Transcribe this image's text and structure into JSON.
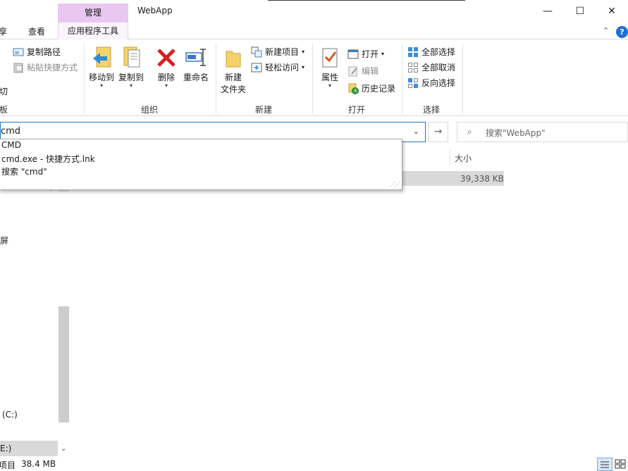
{
  "window": {
    "title": "WebApp",
    "context_header": "管理",
    "buttons": {
      "minimize": "—",
      "maximize": "☐",
      "close": "✕"
    }
  },
  "tabs": {
    "share": "享",
    "view": "查看",
    "app_tools": "应用程序工具"
  },
  "ribbon": {
    "clipboard": {
      "copy_path": "复制路径",
      "paste_shortcut": "粘贴快捷方式",
      "cut": "切",
      "label": "板"
    },
    "organize": {
      "move_to": "移动到",
      "copy_to": "复制到",
      "delete": "删除",
      "rename": "重命名",
      "label": "组织"
    },
    "new": {
      "new_folder_line1": "新建",
      "new_folder_line2": "文件夹",
      "new_item": "新建项目",
      "easy_access": "轻松访问",
      "label": "新建"
    },
    "open": {
      "properties": "属性",
      "open": "打开",
      "edit": "编辑",
      "history": "历史记录",
      "label": "打开"
    },
    "select": {
      "select_all": "全部选择",
      "select_none": "全部取消",
      "invert": "反向选择",
      "label": "选择"
    }
  },
  "address": {
    "value": "cmd",
    "go_arrow": "→",
    "dropdown_caret": "⌄"
  },
  "search": {
    "placeholder": "搜索\"WebApp\""
  },
  "suggestions": [
    "CMD",
    "cmd.exe - 快捷方式.lnk",
    "搜索 \"cmd\""
  ],
  "file_list": {
    "size_header": "大小",
    "rows": [
      {
        "size": "39,338 KB"
      }
    ]
  },
  "nav": {
    "screen_fragment": "屏",
    "drive_c": "(C:)",
    "drive_e": "E:)"
  },
  "status": {
    "text": "项目",
    "size": "38.4 MB"
  },
  "colors": {
    "accent": "#1979ca",
    "context_tab": "#e8c8f0",
    "selection": "#d9d9d9"
  }
}
